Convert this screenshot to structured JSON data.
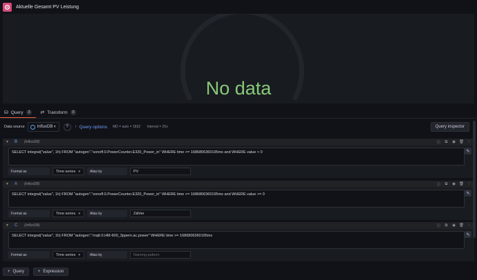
{
  "panel": {
    "title": "Aktuelle Gesamt PV Leistung",
    "no_data": "No data"
  },
  "tabs": [
    {
      "label": "Query",
      "count": "3",
      "icon": "database-icon"
    },
    {
      "label": "Transform",
      "count": "0",
      "icon": "transform-icon"
    }
  ],
  "datasource": {
    "label": "Data source",
    "selected": "InfluxDB",
    "query_options_label": "Query options",
    "md": "MD = auto = 1832",
    "interval": "Interval = 20s",
    "inspector_label": "Query inspector"
  },
  "queries": [
    {
      "ref": "B",
      "ds": "(InfluxDB)",
      "text": "SELECT integral(\"value\", 1h) FROM \"autogen\".\"sonoff.0.PowerCounter.E320_Power_in\" WHERE time >= 1686806360195ms and WHERE value < 0",
      "format_label": "Format as",
      "format": "Time series",
      "alias_label": "Alias by",
      "alias": "PV"
    },
    {
      "ref": "A",
      "ds": "(InfluxDB)",
      "text": "SELECT integral(\"value\", 1h) FROM \"autogen\".\"sonoff.0.PowerCounter.E320_Power_in\" WHERE time >= 1686806360195ms and WHERE value >= 0",
      "format_label": "Format as",
      "format": "Time series",
      "alias_label": "Alias by",
      "alias": "Zähler"
    },
    {
      "ref": "C",
      "ds": "(InfluxDB)",
      "text": "SELECT integral(\"value\", 1h) FROM \"autogen\".\"mqtt.0.HM-600_3ppern.ac.power\" WHERE time >= 1686806360195ms",
      "format_label": "Format as",
      "format": "Time series",
      "alias_label": "Alias by",
      "alias_placeholder": "Naming pattern"
    }
  ],
  "bottom": {
    "add_query": "Query",
    "add_expression": "Expression"
  },
  "colors": {
    "no_data": "#89c97a",
    "accent": "#f55f3e",
    "link": "#6e9fff"
  }
}
